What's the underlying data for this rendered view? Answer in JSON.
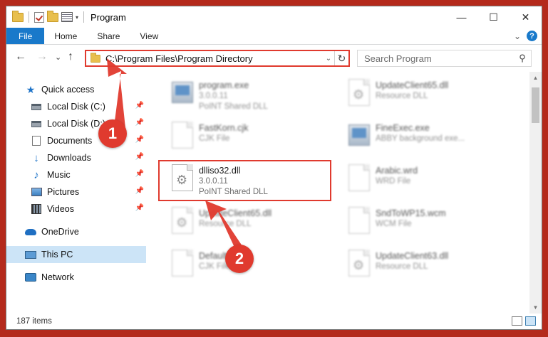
{
  "window": {
    "title": "Program",
    "minimize": "—",
    "maximize": "☐",
    "close": "✕"
  },
  "ribbon": {
    "tabs": [
      "File",
      "Home",
      "Share",
      "View"
    ],
    "collapse_glyph": "⌄",
    "help_glyph": "?"
  },
  "nav": {
    "back": "←",
    "forward": "→",
    "recent": "⌄",
    "up": "↑",
    "address": "C:\\Program Files\\Program Directory",
    "address_dropdown": "⌄",
    "refresh": "↻",
    "search_placeholder": "Search Program",
    "search_glyph": "⚲"
  },
  "sidebar": {
    "items": [
      {
        "label": "Quick access",
        "icon": "star-icon",
        "pinned": false
      },
      {
        "label": "Local Disk (C:)",
        "icon": "disk-icon",
        "pinned": true
      },
      {
        "label": "Local Disk (D:)",
        "icon": "disk-icon",
        "pinned": true
      },
      {
        "label": "Documents",
        "icon": "documents-icon",
        "pinned": true
      },
      {
        "label": "Downloads",
        "icon": "download-icon",
        "pinned": true
      },
      {
        "label": "Music",
        "icon": "music-icon",
        "pinned": true
      },
      {
        "label": "Pictures",
        "icon": "pictures-icon",
        "pinned": true
      },
      {
        "label": "Videos",
        "icon": "videos-icon",
        "pinned": true
      },
      {
        "label": "OneDrive",
        "icon": "onedrive-icon",
        "pinned": false
      },
      {
        "label": "This PC",
        "icon": "pc-icon",
        "pinned": false,
        "selected": true
      },
      {
        "label": "Network",
        "icon": "network-icon",
        "pinned": false
      }
    ],
    "pin_glyph": "📌"
  },
  "files": {
    "left": [
      {
        "name": "program.exe",
        "line1": "3.0.0.11",
        "line2": "PoINT Shared DLL",
        "icon": "exe-icon",
        "blurred": true
      },
      {
        "name": "FastKorn.cjk",
        "line1": "CJK File",
        "line2": "",
        "icon": "document-icon",
        "blurred": true
      },
      {
        "name": "dlliso32.dll",
        "line1": "3.0.0.11",
        "line2": "PoINT Shared DLL",
        "icon": "dll-gear-icon",
        "blurred": false,
        "highlighted": true
      },
      {
        "name": "UpdateClient65.dll",
        "line1": "Resource DLL",
        "line2": "",
        "icon": "dll-gear-icon",
        "blurred": true
      },
      {
        "name": "Default.cjk",
        "line1": "CJK File",
        "line2": "",
        "icon": "document-icon",
        "blurred": true
      }
    ],
    "right": [
      {
        "name": "UpdateClient65.dll",
        "line1": "Resource DLL",
        "line2": "",
        "icon": "dll-gear-icon",
        "blurred": true
      },
      {
        "name": "FineExec.exe",
        "line1": "ABBY background exe...",
        "line2": "",
        "icon": "exe-icon",
        "blurred": true
      },
      {
        "name": "Arabic.wrd",
        "line1": "WRD File",
        "line2": "",
        "icon": "document-icon",
        "blurred": true
      },
      {
        "name": "SndToWP15.wcm",
        "line1": "WCM File",
        "line2": "",
        "icon": "document-icon",
        "blurred": true
      },
      {
        "name": "UpdateClient63.dll",
        "line1": "Resource DLL",
        "line2": "",
        "icon": "dll-gear-icon",
        "blurred": true
      }
    ]
  },
  "status": {
    "items_count": "187 items"
  },
  "callouts": {
    "step1": "1",
    "step2": "2",
    "color": "#e03a2e"
  },
  "colors": {
    "accent": "#1979ca",
    "selected_bg": "#cce4f7",
    "highlight": "#e03a2e"
  }
}
